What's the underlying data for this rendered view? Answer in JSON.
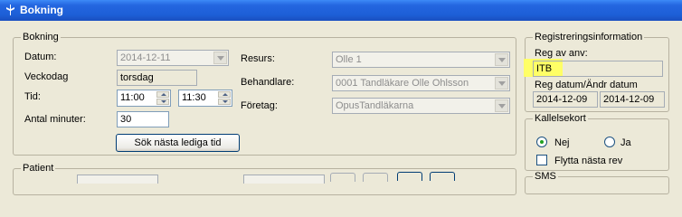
{
  "window": {
    "title": "Bokning"
  },
  "bokning": {
    "legend": "Bokning",
    "datum_label": "Datum:",
    "datum_value": "2014-12-11",
    "veckodag_label": "Veckodag",
    "veckodag_value": "torsdag",
    "tid_label": "Tid:",
    "tid_from": "11:00",
    "tid_to": "11:30",
    "antal_label": "Antal minuter:",
    "antal_value": "30",
    "resurs_label": "Resurs:",
    "resurs_value": "Olle 1",
    "behandlare_label": "Behandlare:",
    "behandlare_value": "0001 Tandläkare Olle Ohlsson",
    "foretag_label": "Företag:",
    "foretag_value": "OpusTandläkarna",
    "search_button": "Sök nästa lediga tid"
  },
  "patient": {
    "legend": "Patient"
  },
  "registrering": {
    "legend": "Registreringsinformation",
    "reg_av_label": "Reg av anv:",
    "reg_av_value": "ITB",
    "reg_datum_label": "Reg datum/Ändr datum",
    "reg_datum": "2014-12-09",
    "andr_datum": "2014-12-09"
  },
  "kallelse": {
    "legend": "Kallelsekort",
    "nej_label": "Nej",
    "ja_label": "Ja",
    "selected": "Nej",
    "flytta_label": "Flytta nästa rev"
  },
  "sms": {
    "legend": "SMS"
  },
  "colors": {
    "titlebar": "#1d5fd7",
    "highlight": "#ffff66"
  }
}
